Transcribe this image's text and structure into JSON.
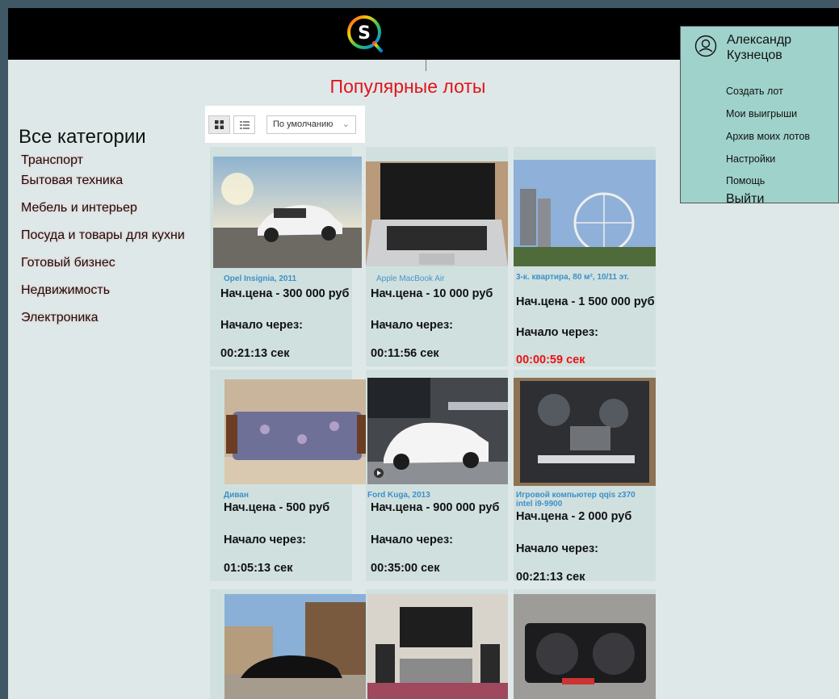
{
  "header": {
    "logo_letters": "SQ"
  },
  "page_title": "Популярные лоты",
  "sidebar": {
    "title": "Все категории",
    "items": [
      {
        "label": "Транспорт"
      },
      {
        "label": "Бытовая техника"
      },
      {
        "label": "Мебель и интерьер"
      },
      {
        "label": "Посуда и товары для кухни"
      },
      {
        "label": "Готовый бизнес"
      },
      {
        "label": "Недвижимость"
      },
      {
        "label": "Электроника"
      }
    ]
  },
  "toolbar": {
    "grid_view_icon": "grid-icon",
    "list_view_icon": "list-icon",
    "sort_value": "По умолчанию",
    "sort_icon": "chevron-down-icon"
  },
  "lots": [
    {
      "name": "Opel Insignia, 2011",
      "price": "Нач.цена - 300 000 руб",
      "start_label": "Начало через:",
      "timer": "00:21:13 сек",
      "urgent": false
    },
    {
      "name": "Apple MacBook Air",
      "price": "Нач.цена - 10 000 руб",
      "start_label": "Начало через:",
      "timer": "00:11:56 сек",
      "urgent": false
    },
    {
      "name": "3-к. квартира, 80 м², 10/11 эт.",
      "price": "Нач.цена - 1 500 000 руб",
      "start_label": "Начало через:",
      "timer": "00:00:59 сек",
      "urgent": true
    },
    {
      "name": "Диван",
      "price": "Нач.цена - 500 руб",
      "start_label": "Начало через:",
      "timer": "01:05:13 сек",
      "urgent": false
    },
    {
      "name": "Ford Kuga, 2013",
      "price": "Нач.цена - 900 000 руб",
      "start_label": "Начало через:",
      "timer": "00:35:00 сек",
      "urgent": false
    },
    {
      "name": "Игровой компьютер qqis z370 intel i9-9900",
      "price": "Нач.цена - 2 000 руб",
      "start_label": "Начало через:",
      "timer": "00:21:13 сек",
      "urgent": false
    },
    {
      "name": "",
      "price": "",
      "start_label": "",
      "timer": "",
      "urgent": false
    },
    {
      "name": "",
      "price": "",
      "start_label": "",
      "timer": "",
      "urgent": false
    },
    {
      "name": "",
      "price": "",
      "start_label": "",
      "timer": "",
      "urgent": false
    }
  ],
  "user_menu": {
    "avatar_icon": "user-icon",
    "first_name": "Александр",
    "last_name": "Кузнецов",
    "items": [
      {
        "label": "Создать лот"
      },
      {
        "label": "Мои выигрыши"
      },
      {
        "label": "Архив моих лотов"
      },
      {
        "label": "Настройки"
      },
      {
        "label": "Помощь"
      }
    ],
    "logout": "Выйти"
  },
  "colors": {
    "accent_title": "#e0141b",
    "lot_name": "#3f8fc9",
    "urgent_timer": "#ee1111",
    "menu_bg": "#9fd2cb",
    "card_bg": "#cfe0df"
  }
}
